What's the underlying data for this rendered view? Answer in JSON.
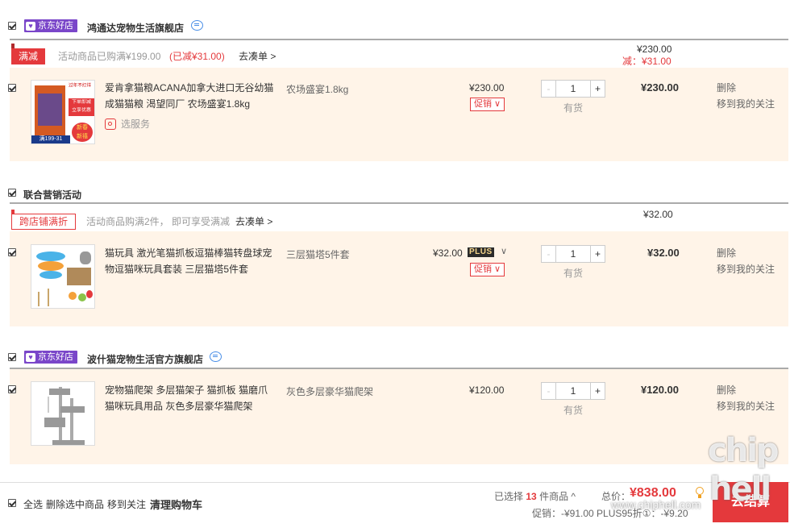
{
  "store1": {
    "badge": "京东好店",
    "name": "鸿通达宠物生活旗舰店",
    "promo_tag": "满减",
    "promo_text": "活动商品已购满¥199.00",
    "promo_reduced": "(已减¥31.00)",
    "promo_link": "去凑单 >",
    "sum_total": "¥230.00",
    "sum_reduce": "减：¥31.00",
    "item": {
      "title": "爱肯拿猫粮ACANA加拿大进口无谷幼猫成猫猫粮 渴望同厂 农场盛宴1.8kg",
      "service": "选服务",
      "spec": "农场盛宴1.8kg",
      "price": "¥230.00",
      "promo": "促销 ∨",
      "qty": "1",
      "stock": "有货",
      "subtotal": "¥230.00",
      "delete": "删除",
      "follow": "移到我的关注",
      "thumb_texts": [
        "过年不打烊",
        "下单即减",
        "立享优惠",
        "新春",
        "新禧",
        "满199-31"
      ]
    }
  },
  "group2": {
    "name": "联合营销活动",
    "promo_tag": "跨店铺满折",
    "promo_text": "活动商品购满2件， 即可享受满减",
    "promo_link": "去凑单 >",
    "sum_total": "¥32.00",
    "item": {
      "title": "猫玩具 激光笔猫抓板逗猫棒猫转盘球宠物逗猫咪玩具套装 三层猫塔5件套",
      "spec": "三层猫塔5件套",
      "price": "¥32.00",
      "plus": "PLUS",
      "promo": "促销 ∨",
      "qty": "1",
      "stock": "有货",
      "subtotal": "¥32.00",
      "delete": "删除",
      "follow": "移到我的关注"
    }
  },
  "store3": {
    "badge": "京东好店",
    "name": "波什猫宠物生活官方旗舰店",
    "item": {
      "title": "宠物猫爬架 多层猫架子 猫抓板 猫磨爪猫咪玩具用品 灰色多层豪华猫爬架",
      "spec": "灰色多层豪华猫爬架",
      "price": "¥120.00",
      "qty": "1",
      "stock": "有货",
      "subtotal": "¥120.00",
      "delete": "删除",
      "follow": "移到我的关注"
    }
  },
  "footer": {
    "select_all": "全选",
    "delete_selected": "删除选中商品",
    "move_follow": "移到关注",
    "clear_cart": "清理购物车",
    "selected_prefix": "已选择",
    "selected_count": "13",
    "selected_suffix": "件商品 ^",
    "total_label": "总价：",
    "total_value": "¥838.00",
    "detail": "促销：-¥91.00  PLUS95折①：-¥9.20",
    "pay": "去结算"
  },
  "watermark": {
    "url": "www.chiphell.com",
    "logo_top": "chip",
    "logo_bottom": "hell"
  },
  "colors": {
    "accent_red": "#e4393c",
    "jd_purple": "#7a46c9",
    "item_bg": "#fff4e8"
  }
}
